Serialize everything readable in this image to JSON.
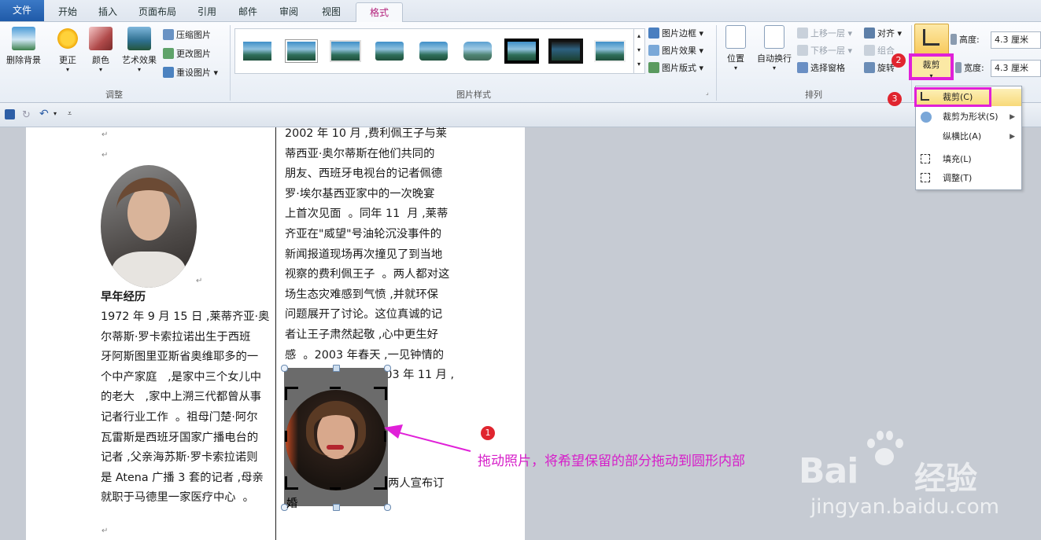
{
  "tabs": [
    {
      "label": "文件"
    },
    {
      "label": "开始"
    },
    {
      "label": "插入"
    },
    {
      "label": "页面布局"
    },
    {
      "label": "引用"
    },
    {
      "label": "邮件"
    },
    {
      "label": "审阅"
    },
    {
      "label": "视图"
    },
    {
      "label": "格式"
    }
  ],
  "ribbon": {
    "remove_bg": "删除背景",
    "correct": "更正",
    "color": "颜色",
    "art_effects": "艺术效果",
    "compress": "压缩图片",
    "change": "更改图片",
    "reset": "重设图片",
    "group_adjust": "调整",
    "group_styles": "图片样式",
    "pic_border": "图片边框",
    "pic_effects": "图片效果",
    "pic_layout": "图片版式",
    "position": "位置",
    "wrap": "自动换行",
    "bring_forward": "上移一层",
    "send_backward": "下移一层",
    "selection_pane": "选择窗格",
    "align": "对齐",
    "group_obj": "组合",
    "rotate": "旋转",
    "group_arrange": "排列",
    "crop": "裁剪",
    "height_label": "高度:",
    "height_value": "4.3 厘米",
    "width_label": "宽度:",
    "width_value": "4.3 厘米"
  },
  "menu": {
    "items": [
      {
        "label": "裁剪(C)",
        "has_submenu": false
      },
      {
        "label": "裁剪为形状(S)",
        "has_submenu": true
      },
      {
        "label": "纵横比(A)",
        "has_submenu": true
      },
      {
        "label": "填充(L)",
        "has_submenu": false
      },
      {
        "label": "调整(T)",
        "has_submenu": false
      }
    ]
  },
  "badges": {
    "b1": "1",
    "b2": "2",
    "b3": "3"
  },
  "document": {
    "left_heading": "早年经历",
    "left_lines": [
      "1972 年 9 月 15 日 ,莱蒂齐亚·奥",
      "尔蒂斯·罗卡索拉诺出生于西班",
      "牙阿斯图里亚斯省奥维耶多的一",
      "个中产家庭   ,是家中三个女儿中",
      "的老大   ,家中上溯三代都曾从事",
      "记者行业工作  。祖母门楚·阿尔",
      "瓦雷斯是西班牙国家广播电台的",
      "记者 ,父亲海苏斯·罗卡索拉诺则",
      "是 Atena 广播 3 套的记者 ,母亲",
      "就职于马德里一家医疗中心  。"
    ],
    "right_lines": [
      "2002 年 10 月 ,费利佩王子与莱",
      "蒂西亚·奥尔蒂斯在他们共同的",
      "朋友、西班牙电视台的记者佩德",
      "罗·埃尔基西亚家中的一次晚宴",
      "上首次见面  。同年 11  月 ,莱蒂",
      "齐亚在\"威望\"号油轮沉没事件的",
      "新闻报道现场再次撞见了到当地",
      "视察的费利佩王子  。两人都对这",
      "场生态灾难感到气愤 ,并就环保",
      "问题展开了讨论。这位真诚的记",
      "者让王子肃然起敬 ,心中更生好",
      "感  。2003 年春天 ,一见钟情的",
      "两人开始秘恋  。2003 年 11 月 ,"
    ],
    "right_tail": "两人宣布订",
    "right_tail2": "婚"
  },
  "annotation": "拖动照片，将希望保留的部分拖动到圆形内部",
  "watermark": {
    "brand": "Bai",
    "cn": "经验",
    "url": "jingyan.baidu.com"
  },
  "colors": {
    "highlight": "#e020d8",
    "badge": "#e0252f",
    "annotation_text": "#d61ec9"
  }
}
